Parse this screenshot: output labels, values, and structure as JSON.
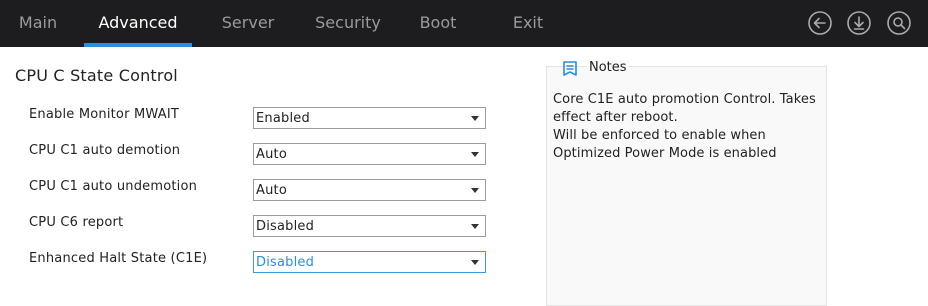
{
  "tabs": [
    {
      "label": "Main"
    },
    {
      "label": "Advanced"
    },
    {
      "label": "Server"
    },
    {
      "label": "Security"
    },
    {
      "label": "Boot"
    },
    {
      "label": "Exit"
    }
  ],
  "active_tab": "Advanced",
  "header_icons": [
    "back-icon",
    "download-icon",
    "search-icon"
  ],
  "section": {
    "title": "CPU C State Control"
  },
  "settings": [
    {
      "label": "Enable Monitor MWAIT",
      "value": "Enabled"
    },
    {
      "label": "CPU C1 auto demotion",
      "value": "Auto"
    },
    {
      "label": "CPU C1 auto undemotion",
      "value": "Auto"
    },
    {
      "label": "CPU C6 report",
      "value": "Disabled"
    },
    {
      "label": "Enhanced Halt State (C1E)",
      "value": "Disabled"
    }
  ],
  "notes": {
    "title": "Notes",
    "text": "Core C1E auto promotion Control. Takes effect after reboot.\nWill be enforced to enable when Optimized Power Mode is enabled"
  },
  "colors": {
    "header_bg": "#1d1d1f",
    "accent": "#2a8fdc",
    "inactive_tab": "#9a9a9a"
  }
}
